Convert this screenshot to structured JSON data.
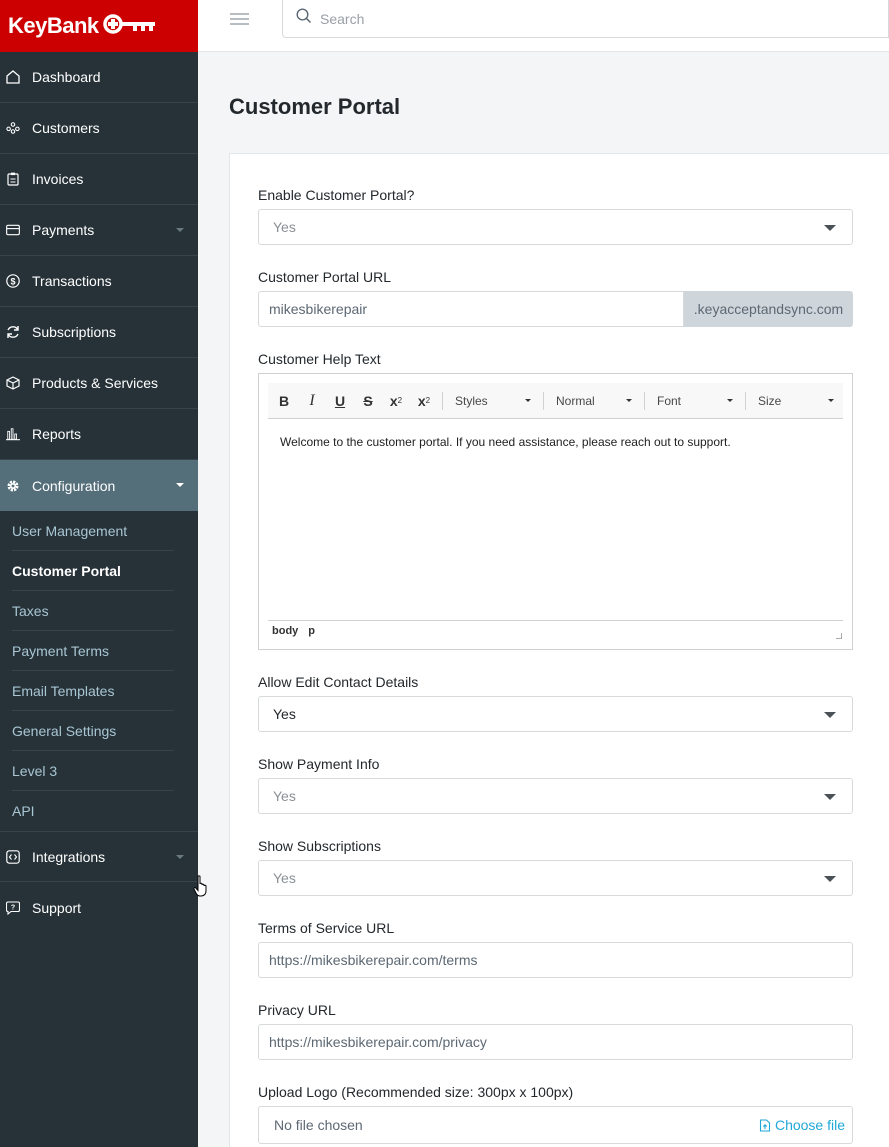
{
  "brand": {
    "name": "KeyBank",
    "color": "#cc0000"
  },
  "search": {
    "placeholder": "Search"
  },
  "sidebar": {
    "items": [
      {
        "label": "Dashboard",
        "icon": "home-icon"
      },
      {
        "label": "Customers",
        "icon": "users-icon"
      },
      {
        "label": "Invoices",
        "icon": "clipboard-icon"
      },
      {
        "label": "Payments",
        "icon": "credit-card-icon"
      },
      {
        "label": "Transactions",
        "icon": "dollar-circle-icon"
      },
      {
        "label": "Subscriptions",
        "icon": "refresh-icon"
      },
      {
        "label": "Products & Services",
        "icon": "box-icon"
      },
      {
        "label": "Reports",
        "icon": "bar-chart-icon"
      },
      {
        "label": "Configuration",
        "icon": "gear-icon"
      },
      {
        "label": "Integrations",
        "icon": "code-icon"
      },
      {
        "label": "Support",
        "icon": "help-chat-icon"
      }
    ],
    "config_sub": [
      "User Management",
      "Customer Portal",
      "Taxes",
      "Payment Terms",
      "Email Templates",
      "General Settings",
      "Level 3",
      "API"
    ]
  },
  "page": {
    "title": "Customer Portal"
  },
  "form": {
    "enable_portal": {
      "label": "Enable Customer Portal?",
      "value": "Yes"
    },
    "portal_url": {
      "label": "Customer Portal URL",
      "value": "mikesbikerepair",
      "suffix": ".keyacceptandsync.com"
    },
    "help_text": {
      "label": "Customer Help Text",
      "toolbar": {
        "styles": "Styles",
        "format": "Normal",
        "font": "Font",
        "size": "Size"
      },
      "content": "Welcome to the customer portal. If you need assistance, please reach out to support.",
      "path": [
        "body",
        "p"
      ]
    },
    "allow_edit": {
      "label": "Allow Edit Contact Details",
      "value": "Yes"
    },
    "show_payment": {
      "label": "Show Payment Info",
      "value": "Yes"
    },
    "show_subs": {
      "label": "Show Subscriptions",
      "value": "Yes"
    },
    "terms_url": {
      "label": "Terms of Service URL",
      "value": "https://mikesbikerepair.com/terms"
    },
    "privacy_url": {
      "label": "Privacy URL",
      "value": "https://mikesbikerepair.com/privacy"
    },
    "logo": {
      "label": "Upload Logo (Recommended size: 300px x 100px)",
      "file": "No file chosen",
      "button": "Choose file"
    }
  }
}
